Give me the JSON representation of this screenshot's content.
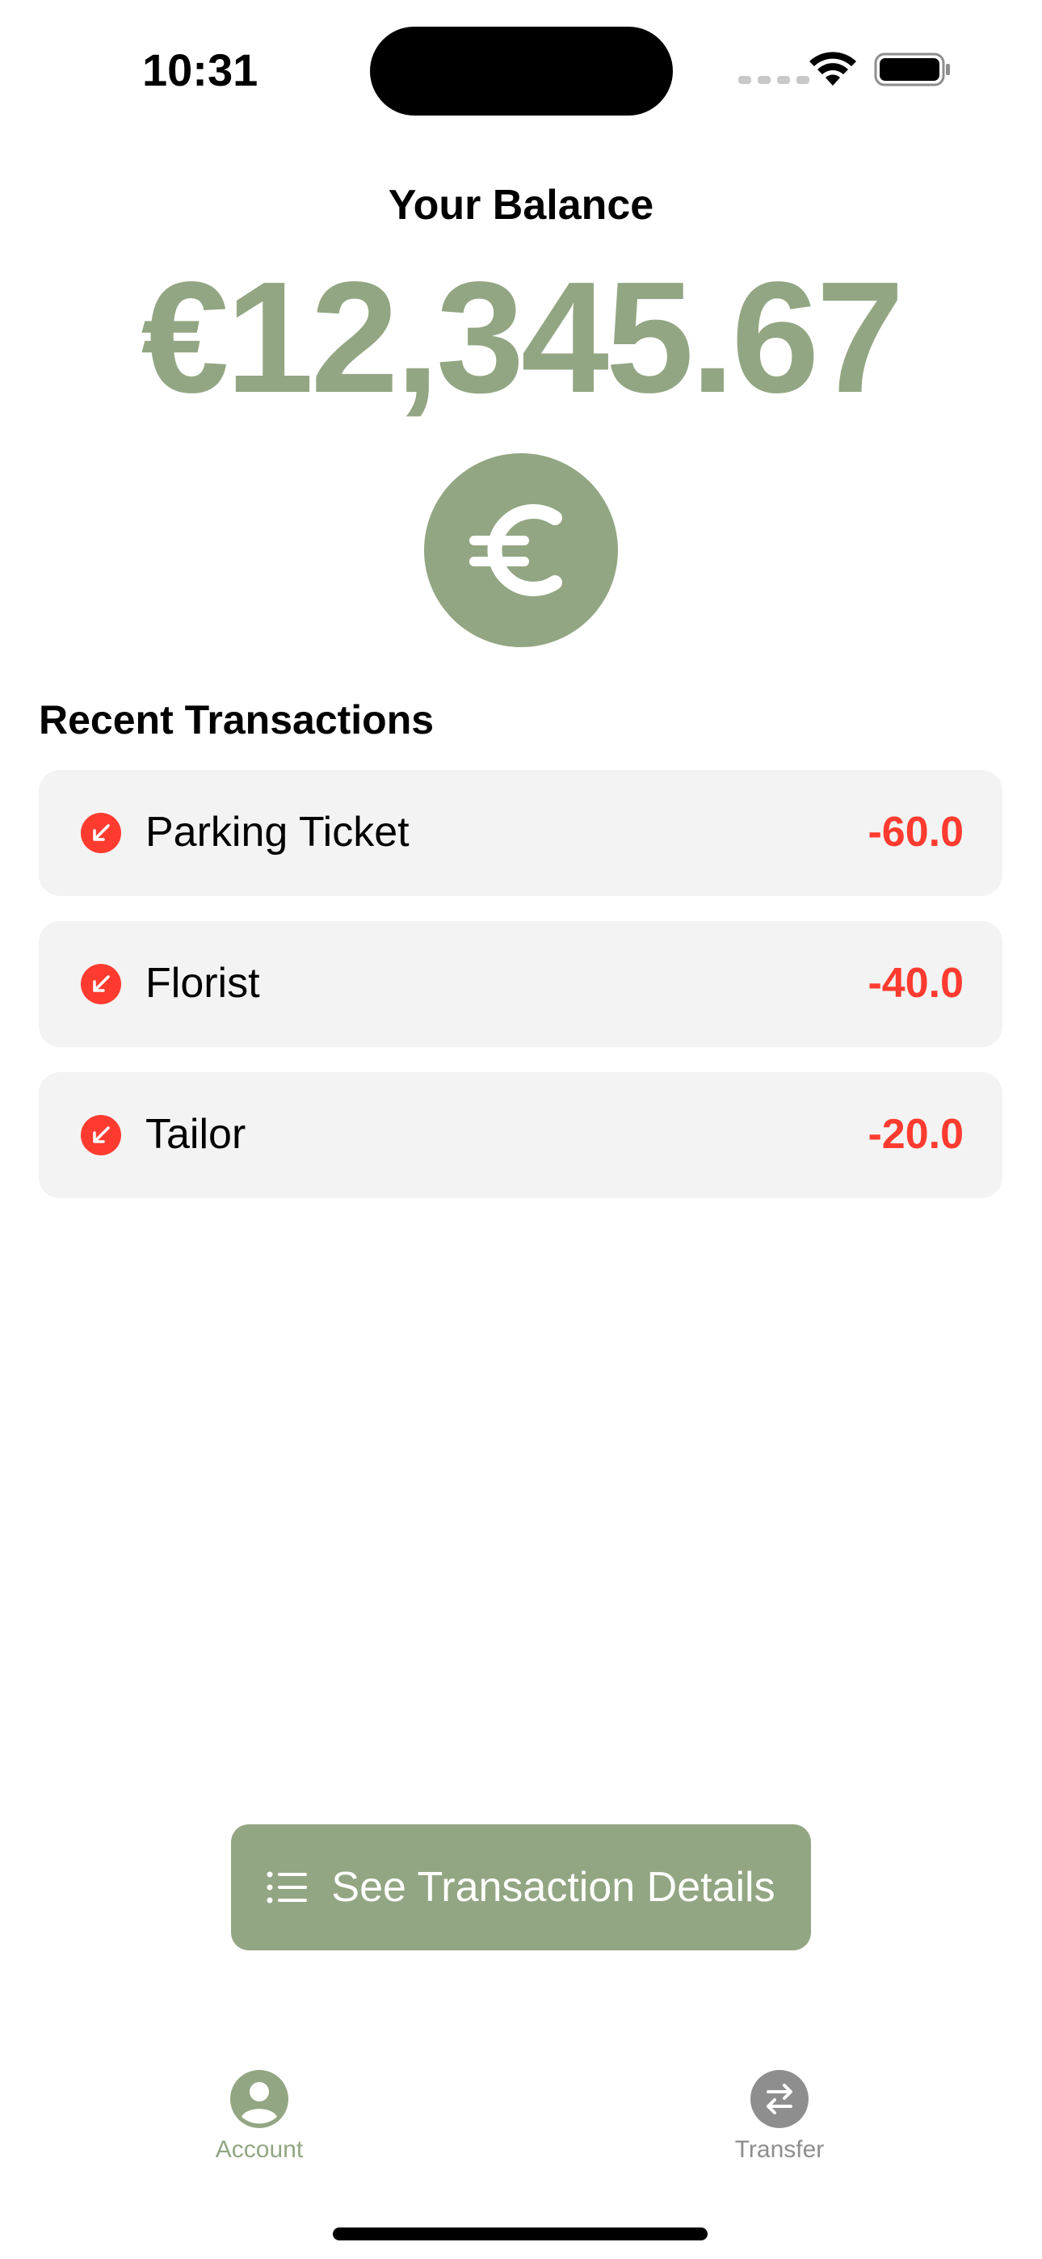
{
  "status_bar": {
    "time": "10:31"
  },
  "balance": {
    "title": "Your Balance",
    "amount": "€12,345.67",
    "currency_icon": "euro-icon"
  },
  "transactions": {
    "title": "Recent Transactions",
    "items": [
      {
        "name": "Parking Ticket",
        "amount": "-60.0",
        "icon": "arrow-down-left-icon"
      },
      {
        "name": "Florist",
        "amount": "-40.0",
        "icon": "arrow-down-left-icon"
      },
      {
        "name": "Tailor",
        "amount": "-20.0",
        "icon": "arrow-down-left-icon"
      }
    ]
  },
  "details_button": {
    "label": "See Transaction Details",
    "icon": "list-icon"
  },
  "tab_bar": {
    "tabs": [
      {
        "label": "Account",
        "icon": "person-icon",
        "active": true
      },
      {
        "label": "Transfer",
        "icon": "transfer-arrows-icon",
        "active": false
      }
    ]
  },
  "colors": {
    "accent": "#93a683",
    "negative": "#ff3b30",
    "card_background": "#f3f3f3",
    "inactive_tab": "#8e8e8e"
  }
}
